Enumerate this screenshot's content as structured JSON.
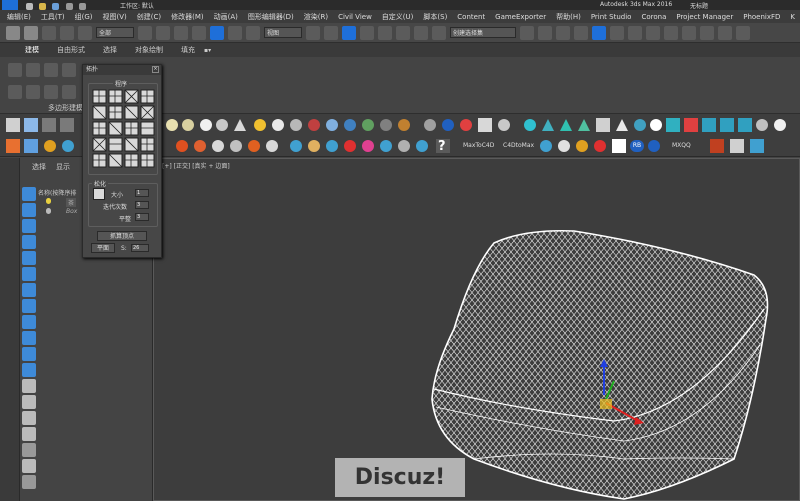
{
  "app": {
    "title": "Autodesk 3ds Max 2016",
    "doc_title": "无标题",
    "workspace": "工作区: 默认"
  },
  "menu": [
    "编辑(E)",
    "工具(T)",
    "组(G)",
    "视图(V)",
    "创建(C)",
    "修改器(M)",
    "动画(A)",
    "图形编辑器(D)",
    "渲染(R)",
    "Civil View",
    "自定义(U)",
    "脚本(S)",
    "Content",
    "GameExporter",
    "帮助(H)",
    "Print Studio",
    "Corona",
    "Project Manager",
    "PhoenixFD",
    "K"
  ],
  "toolbar": {
    "filter_value": "全部",
    "view_value": "视图",
    "selection_set": "创建选择集"
  },
  "ribbon": {
    "tabs": [
      "建模",
      "自由形式",
      "选择",
      "对象绘制",
      "填充"
    ],
    "sub_label": "多边形建模"
  },
  "toolbar3_text": [
    "MaxToC4D",
    "C4DtoMax",
    "RB",
    "MXQQ"
  ],
  "side_panel": {
    "tabs": [
      "选择",
      "显示"
    ],
    "tree_header": "名称(按降序排",
    "tree_items": [
      "茶",
      "Box"
    ]
  },
  "viewport": {
    "label": "[+] [正交] [真实 + 边面]"
  },
  "topology_dialog": {
    "title": "拓扑",
    "pattern_group": "程序",
    "relax_group": "松化",
    "size_label": "大小",
    "size_value": "1",
    "iterations_label": "迭代次数",
    "iterations_value": "3",
    "smooth_label": "平整",
    "smooth_value": "3",
    "capture_button": "抓算顶点",
    "plane_button": "平面",
    "plane_value": "26",
    "plane_prefix": "S:"
  },
  "watermark": "Discuz!",
  "colors": {
    "accent": "#1e6fd9",
    "bg": "#444444",
    "mesh": "#ffffff",
    "gizmo_x": "#e02020",
    "gizmo_y": "#20b020",
    "gizmo_z": "#2040e0",
    "gizmo_center": "#f0c020"
  }
}
